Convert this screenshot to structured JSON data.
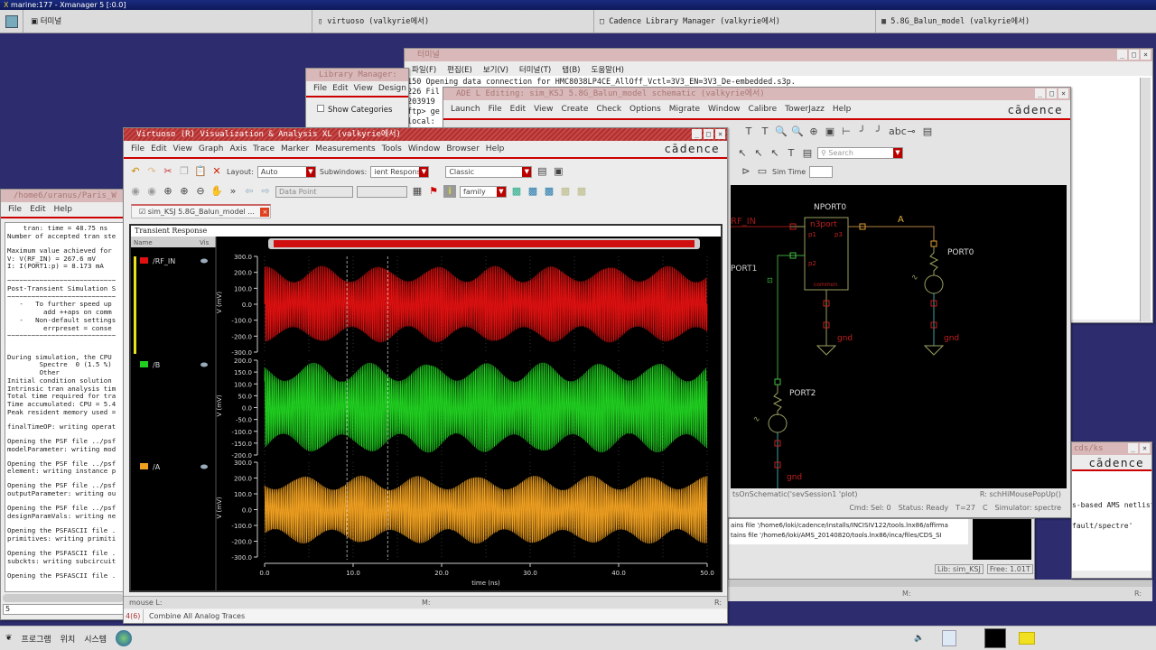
{
  "xmanager": {
    "title": "marine:177 - Xmanager 5 [:0.0]"
  },
  "taskbar": {
    "tasks": [
      {
        "label": "터미널"
      },
      {
        "label": "virtuoso (valkyrie에서)"
      },
      {
        "label": "Cadence Library Manager (valkyrie에서)"
      },
      {
        "label": "5.8G_Balun_model (valkyrie에서)"
      }
    ]
  },
  "bottom_panel": {
    "programs": "프로그램",
    "places": "위치",
    "system": "시스템"
  },
  "terminal": {
    "title": "터미널",
    "menu": [
      "파일(F)",
      "편집(E)",
      "보기(V)",
      "터미널(T)",
      "탭(B)",
      "도움말(H)"
    ],
    "lines": [
      "150 Opening data connection for HMC8038LP4CE_AllOff_Vctl=3V3_EN=3V3_De-embedded.s3p.",
      "226 Fil",
      "203919",
      "ftp> ge",
      "local:"
    ]
  },
  "library_manager": {
    "title": "Library Manager:",
    "menu": [
      "File",
      "Edit",
      "View",
      "Design"
    ],
    "show_categories": "Show Categories"
  },
  "ade": {
    "title": "ADE L Editing: sim_KSJ 5.8G_Balun_model schematic (valkyrie에서)",
    "menu": [
      "Launch",
      "File",
      "Edit",
      "View",
      "Create",
      "Check",
      "Options",
      "Migrate",
      "Window",
      "Calibre",
      "TowerJazz",
      "Help"
    ],
    "brand": "cādence",
    "search_placeholder": "Search",
    "sim_time_label": "Sim Time",
    "schematic": {
      "npport": "NPORT0",
      "n3port": "n3port",
      "p1": "p1",
      "p2": "p2",
      "p3": "p3",
      "common": "common",
      "rf_in": "RF_IN",
      "port1": "PORT1",
      "port0": "PORT0",
      "port2": "PORT2",
      "net_a": "A",
      "gnd": "gnd"
    },
    "mouse_left": "tsOnSchematic('sevSession1 'plot)",
    "mouse_right": "R: schHiMousePopUp()",
    "status": {
      "cmd": "Cmd: Sel: 0",
      "state": "Status: Ready",
      "temp": "T=27",
      "unit": "C",
      "simulator": "Simulator: spectre"
    }
  },
  "ciw": {
    "lines": [
      "ains file '/home6/loki/cadence/installs/INCISIV122/tools.lnx86/affirma",
      "tains file '/home6/loki/AMS_20140820/tools.lnx86/inca/files/CDS_SI"
    ],
    "lib": "Lib: sim_KSJ",
    "free": "Free: 1.01T",
    "m": "M:",
    "r": "R:"
  },
  "cds_window": {
    "title": "cds/ks",
    "brand": "cādence",
    "lines": [
      "s-based AMS netlister.",
      "",
      "fault/spectre'"
    ]
  },
  "log": {
    "title": "/home6/uranus/Paris_W",
    "menu": [
      "File",
      "Edit",
      "Help"
    ],
    "prompt": "5",
    "lines": [
      "    tran: time = 48.75 ns",
      "Number of accepted tran ste",
      "",
      "Maximum value achieved for",
      "V: V(RF_IN) = 267.6 mV",
      "I: I(PORT1:p) = 8.173 mA",
      "",
      "~~~~~~~~~~~~~~~~~~~~~~~~~~~",
      "Post-Transient Simulation S",
      "~~~~~~~~~~~~~~~~~~~~~~~~~~~",
      "   -   To further speed up",
      "         add ++aps on comm",
      "   -   Non-default settings",
      "         errpreset = conse",
      "~~~~~~~~~~~~~~~~~~~~~~~~~~~",
      "",
      "",
      "During simulation, the CPU",
      "        Spectre  0 (1.5 %)",
      "        Other",
      "Initial condition solution",
      "Intrinsic tran analysis tim",
      "Total time required for tra",
      "Time accumulated: CPU = 5.4",
      "Peak resident memory used =",
      "",
      "finalTimeOP: writing operat",
      "",
      "Opening the PSF file ../psf",
      "modelParameter: writing mod",
      "",
      "Opening the PSF file ../psf",
      "element: writing instance p",
      "",
      "Opening the PSF file ../psf",
      "outputParameter: writing ou",
      "",
      "Opening the PSF file ../psf",
      "designParamVals: writing ne",
      "",
      "Opening the PSFASCII file .",
      "primitives: writing primiti",
      "",
      "Opening the PSFASCII file .",
      "subckts: writing subcircuit",
      "",
      "Opening the PSFASCII file ."
    ]
  },
  "viva": {
    "title": "Virtuoso (R) Visualization & Analysis XL (valkyrie에서)",
    "menu": [
      "File",
      "Edit",
      "View",
      "Graph",
      "Axis",
      "Trace",
      "Marker",
      "Measurements",
      "Tools",
      "Window",
      "Browser",
      "Help"
    ],
    "brand": "cādence",
    "layout_label": "Layout:",
    "layout_value": "Auto",
    "subwindows_label": "Subwindows:",
    "subwindows_value": "ient Response",
    "style_value": "Classic",
    "marker_value": "Data Point",
    "family_value": "family",
    "tab": "sim_KSJ 5.8G_Balun_model ...",
    "panel_title": "Transient Response",
    "col_name": "Name",
    "col_vis": "Vis",
    "mouse_l": "mouse L:",
    "mouse_m": "M:",
    "mouse_r": "R:",
    "status_count": "4(6)",
    "status_msg": "Combine All Analog Traces"
  },
  "chart_data": {
    "type": "line",
    "title": "Transient Response",
    "xlabel": "time (ns)",
    "xlim": [
      0,
      50
    ],
    "xticks": [
      "0.0",
      "10.0",
      "20.0",
      "30.0",
      "40.0",
      "50.0"
    ],
    "series": [
      {
        "name": "/RF_IN",
        "color": "#e01010",
        "ylabel": "V (mV)",
        "ylim": [
          -300,
          300
        ],
        "yticks": [
          "300.0",
          "200.0",
          "100.0",
          "0.0",
          "-100.0",
          "-200.0",
          "-300.0"
        ],
        "amplitude": 240,
        "peak": 267.6
      },
      {
        "name": "/B",
        "color": "#20d020",
        "ylabel": "V (mV)",
        "ylim": [
          -200,
          200
        ],
        "yticks": [
          "200.0",
          "150.0",
          "100.0",
          "50.0",
          "0.0",
          "-50.0",
          "-100.0",
          "-150.0",
          "-200.0"
        ],
        "amplitude": 190
      },
      {
        "name": "/A",
        "color": "#f0a020",
        "ylabel": "V (mV)",
        "ylim": [
          -300,
          300
        ],
        "yticks": [
          "300.0",
          "200.0",
          "100.0",
          "0.0",
          "-100.0",
          "-200.0",
          "-300.0"
        ],
        "amplitude": 215
      }
    ],
    "cursors_ns": [
      9.3,
      13.9
    ]
  }
}
